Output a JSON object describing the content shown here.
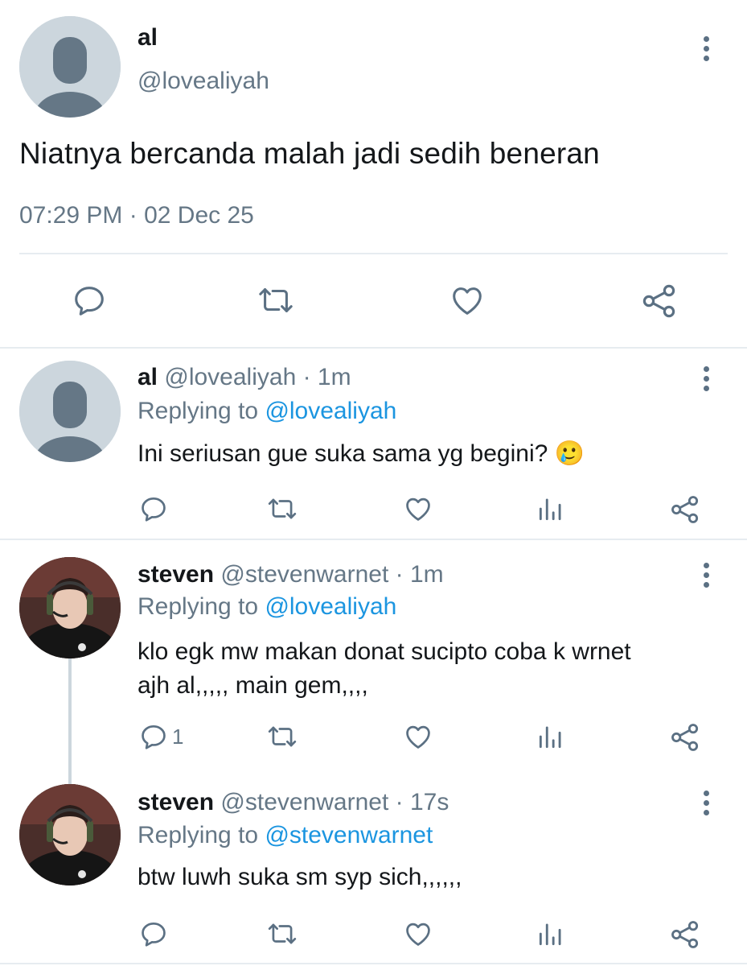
{
  "main_tweet": {
    "display_name": "al",
    "handle": "@lovealiyah",
    "text": "Niatnya bercanda malah jadi sedih beneran",
    "timestamp": "07:29 PM · 02 Dec 25"
  },
  "replies": [
    {
      "display_name": "al",
      "handle": "@lovealiyah",
      "time": "· 1m",
      "replying_label": "Replying to",
      "replying_to": "@lovealiyah",
      "text": "Ini seriusan gue suka sama yg begini? 🥲",
      "reply_count": ""
    },
    {
      "display_name": "steven",
      "handle": "@stevenwarnet",
      "time": "· 1m",
      "replying_label": "Replying to",
      "replying_to": "@lovealiyah",
      "text_line1": "klo egk mw makan donat sucipto coba k wrnet",
      "text_line2": "ajh al,,,,, main gem,,,,",
      "reply_count": "1"
    },
    {
      "display_name": "steven",
      "handle": "@stevenwarnet",
      "time": "· 17s",
      "replying_label": "Replying to",
      "replying_to": "@stevenwarnet",
      "text": "btw luwh suka sm syp sich,,,,,,",
      "reply_count": ""
    }
  ],
  "icons": {
    "reply": "reply-icon",
    "retweet": "retweet-icon",
    "like": "heart-icon",
    "analytics": "analytics-icon",
    "share": "share-icon",
    "more": "more-vertical-icon"
  },
  "colors": {
    "link": "#1b95e0",
    "secondary_text": "#657786",
    "icon": "#5b7083",
    "divider": "#e6ecf0"
  }
}
